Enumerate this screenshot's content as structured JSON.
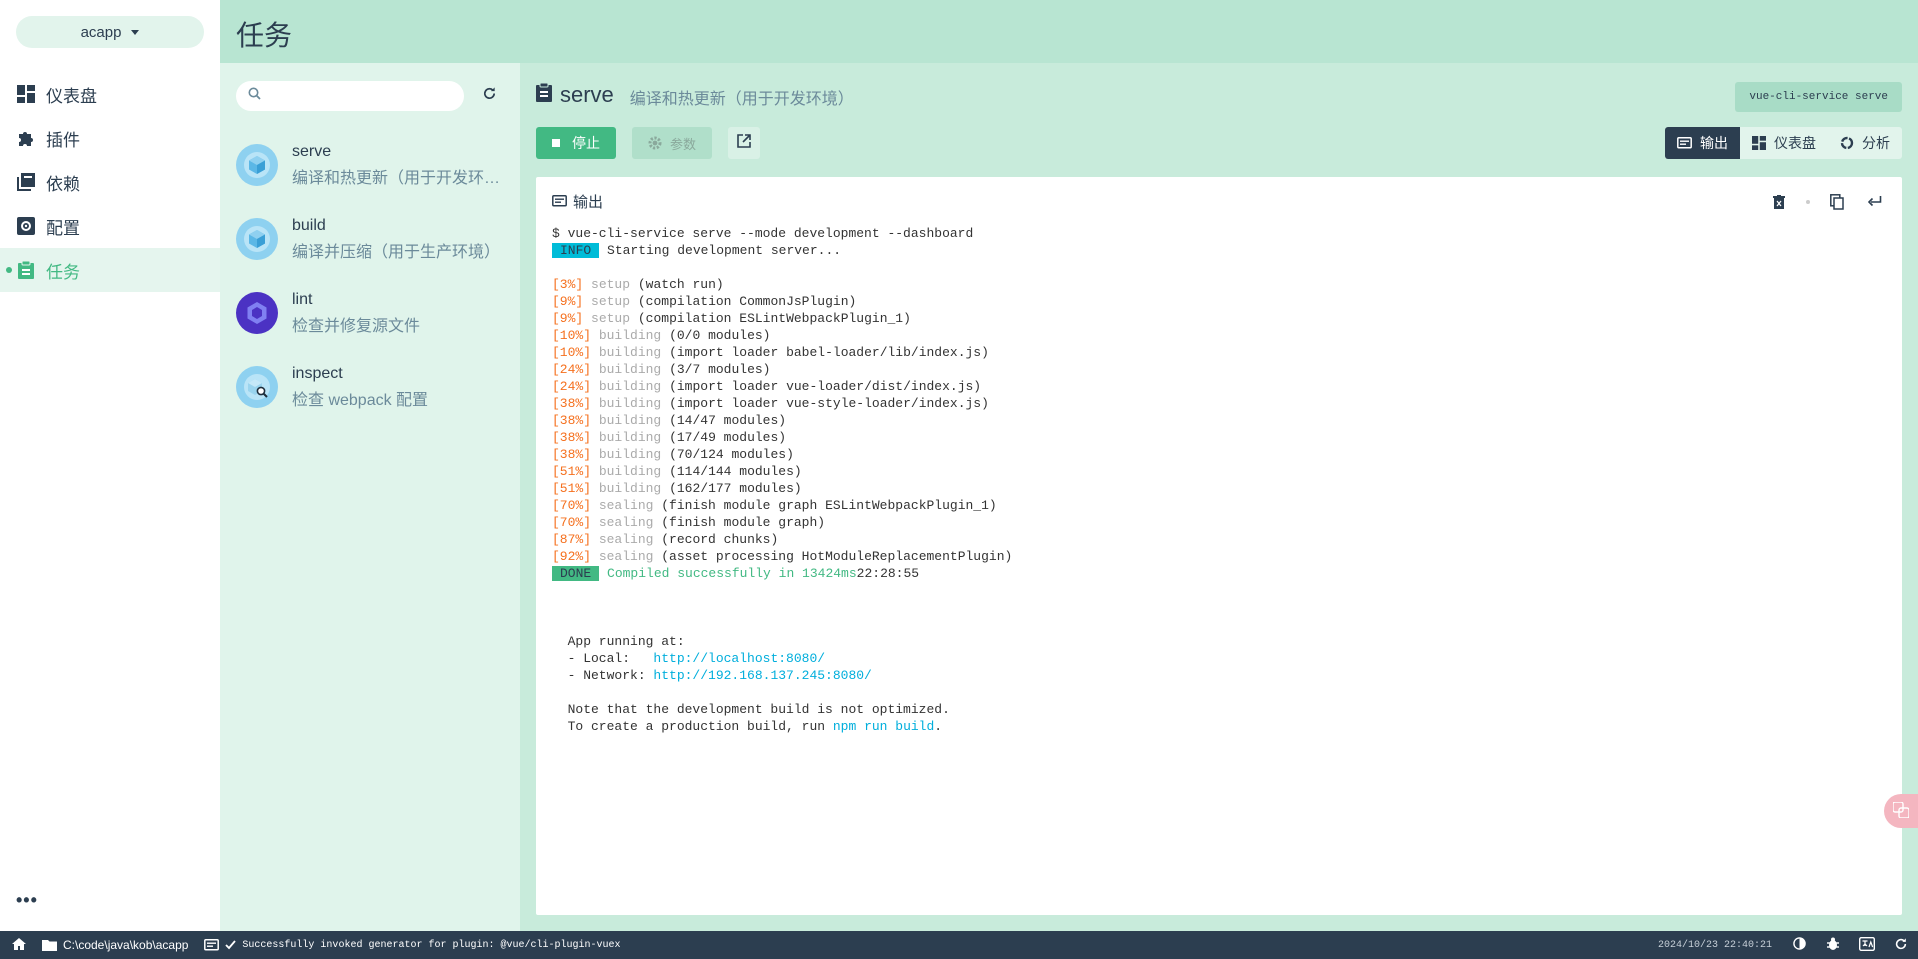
{
  "project": {
    "name": "acapp"
  },
  "nav": {
    "items": [
      {
        "label": "仪表盘",
        "icon": "dashboard-icon"
      },
      {
        "label": "插件",
        "icon": "puzzle-icon"
      },
      {
        "label": "依赖",
        "icon": "library-icon"
      },
      {
        "label": "配置",
        "icon": "settings-icon"
      },
      {
        "label": "任务",
        "icon": "clipboard-icon",
        "active": true
      }
    ],
    "more": "•••"
  },
  "header": {
    "title": "任务"
  },
  "search": {
    "placeholder": "",
    "value": ""
  },
  "tasks": [
    {
      "name": "serve",
      "description": "编译和热更新（用于开发环境）"
    },
    {
      "name": "build",
      "description": "编译并压缩（用于生产环境）"
    },
    {
      "name": "lint",
      "description": "检查并修复源文件"
    },
    {
      "name": "inspect",
      "description": "检查 webpack 配置"
    }
  ],
  "current_task": {
    "name": "serve",
    "description": "编译和热更新（用于开发环境）",
    "command": "vue-cli-service serve"
  },
  "toolbar": {
    "stop_label": "停止",
    "params_label": "参数"
  },
  "view_tabs": [
    {
      "label": "输出",
      "active": true
    },
    {
      "label": "仪表盘"
    },
    {
      "label": "分析"
    }
  ],
  "output": {
    "title": "输出",
    "command_line": "$ vue-cli-service serve --mode development --dashboard",
    "info_tag": "INFO",
    "info_text": " Starting development server...",
    "progress": [
      {
        "pct": "[3%]",
        "phase": "setup",
        "detail": "(watch run)"
      },
      {
        "pct": "[9%]",
        "phase": "setup",
        "detail": "(compilation CommonJsPlugin)"
      },
      {
        "pct": "[9%]",
        "phase": "setup",
        "detail": "(compilation ESLintWebpackPlugin_1)"
      },
      {
        "pct": "[10%]",
        "phase": "building",
        "detail": "(0/0 modules)"
      },
      {
        "pct": "[10%]",
        "phase": "building",
        "detail": "(import loader babel-loader/lib/index.js)"
      },
      {
        "pct": "[24%]",
        "phase": "building",
        "detail": "(3/7 modules)"
      },
      {
        "pct": "[24%]",
        "phase": "building",
        "detail": "(import loader vue-loader/dist/index.js)"
      },
      {
        "pct": "[38%]",
        "phase": "building",
        "detail": "(import loader vue-style-loader/index.js)"
      },
      {
        "pct": "[38%]",
        "phase": "building",
        "detail": "(14/47 modules)"
      },
      {
        "pct": "[38%]",
        "phase": "building",
        "detail": "(17/49 modules)"
      },
      {
        "pct": "[38%]",
        "phase": "building",
        "detail": "(70/124 modules)"
      },
      {
        "pct": "[51%]",
        "phase": "building",
        "detail": "(114/144 modules)"
      },
      {
        "pct": "[51%]",
        "phase": "building",
        "detail": "(162/177 modules)"
      },
      {
        "pct": "[70%]",
        "phase": "sealing",
        "detail": "(finish module graph ESLintWebpackPlugin_1)"
      },
      {
        "pct": "[70%]",
        "phase": "sealing",
        "detail": "(finish module graph)"
      },
      {
        "pct": "[87%]",
        "phase": "sealing",
        "detail": "(record chunks)"
      },
      {
        "pct": "[92%]",
        "phase": "sealing",
        "detail": "(asset processing HotModuleReplacementPlugin)"
      }
    ],
    "done_tag": "DONE",
    "done_text": " Compiled successfully in 13424ms",
    "done_time": "22:28:55",
    "app_running": "  App running at:",
    "local_label": "  - Local:   ",
    "local_url": "http://localhost:8080/",
    "network_label": "  - Network: ",
    "network_url": "http://192.168.137.245:8080/",
    "note1": "  Note that the development build is not optimized.",
    "note2_prefix": "  To create a production build, run ",
    "note2_cmd": "npm run build",
    "note2_suffix": "."
  },
  "statusbar": {
    "path": "C:\\code\\java\\kob\\acapp",
    "message": "Successfully invoked generator for plugin: @vue/cli-plugin-vuex",
    "datetime": "2024/10/23 22:40:21"
  },
  "colors": {
    "accent": "#42b983",
    "dark": "#2c3e50",
    "header": "#b8e5d2"
  }
}
